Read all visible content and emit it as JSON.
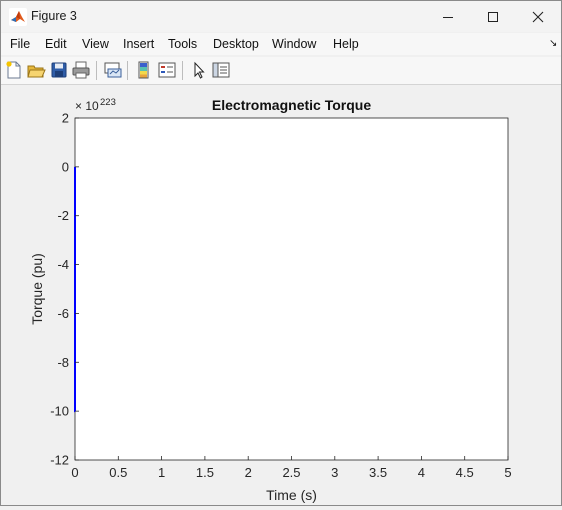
{
  "window": {
    "title": "Figure 3",
    "controls": [
      "minimize",
      "maximize",
      "close"
    ]
  },
  "menubar": {
    "items": [
      "File",
      "Edit",
      "View",
      "Insert",
      "Tools",
      "Desktop",
      "Window",
      "Help"
    ],
    "dock_arrow": "↘"
  },
  "toolbar": {
    "buttons": [
      "new-figure-icon",
      "open-file-icon",
      "save-icon",
      "print-icon",
      "link-plot-icon",
      "colorbar-icon",
      "legend-icon",
      "pointer-icon",
      "property-inspector-icon"
    ]
  },
  "chart_data": {
    "type": "line",
    "title": "Electromagnetic Torque",
    "xlabel": "Time (s)",
    "ylabel": "Torque (pu)",
    "exponent_label": {
      "base": "× 10",
      "power": "223"
    },
    "xlim": [
      0,
      5
    ],
    "ylim": [
      -12,
      2
    ],
    "xticks": [
      "0",
      "0.5",
      "1",
      "1.5",
      "2",
      "2.5",
      "3",
      "3.5",
      "4",
      "4.5",
      "5"
    ],
    "yticks": [
      "2",
      "0",
      "-2",
      "-4",
      "-6",
      "-8",
      "-10",
      "-12"
    ],
    "grid": true,
    "series": [
      {
        "color": "#0000ff",
        "x": [
          0,
          0,
          0.005
        ],
        "y": [
          0,
          -10,
          -10
        ]
      }
    ]
  }
}
